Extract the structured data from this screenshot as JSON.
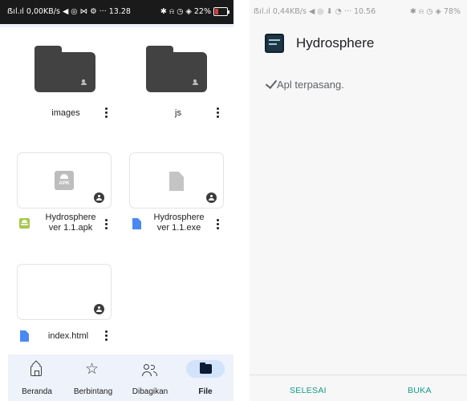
{
  "left_phone": {
    "status_bar": {
      "left": "ẞıl.ıl 0,00KB/s ◀ ◎ ⋈ ⚙ ··· 13.28",
      "right": "✱ ⍾ ◷ ◈ 22%"
    },
    "folders": [
      {
        "name": "images"
      },
      {
        "name": "js"
      }
    ],
    "files": [
      {
        "name_line1": "Hydrosphere",
        "name_line2": "ver 1.1.apk",
        "thumb_label": "APK",
        "type": "apk"
      },
      {
        "name_line1": "Hydrosphere",
        "name_line2": "ver 1.1.exe",
        "type": "document"
      },
      {
        "name_line1": "index.html",
        "type": "document"
      }
    ],
    "bottom_nav": [
      {
        "label": "Beranda",
        "icon": "home-icon"
      },
      {
        "label": "Berbintang",
        "icon": "star-icon",
        "glyph": "☆"
      },
      {
        "label": "Dibagikan",
        "icon": "people-icon"
      },
      {
        "label": "File",
        "icon": "folder-icon",
        "active": true
      }
    ]
  },
  "right_phone": {
    "status_bar": {
      "left": "ẞıl.ıl 0,44KB/s ◀ ◎ ⬇ ◔ ··· 10.56",
      "right": "✱ ⍾ ◷ ◈ 78%"
    },
    "app_name": "Hydrosphere",
    "message": "Apl terpasang.",
    "done_button": "SELESAI",
    "open_button": "BUKA",
    "colors": {
      "button_text": "#0f9d8a",
      "background": "#f7f7f7"
    }
  }
}
